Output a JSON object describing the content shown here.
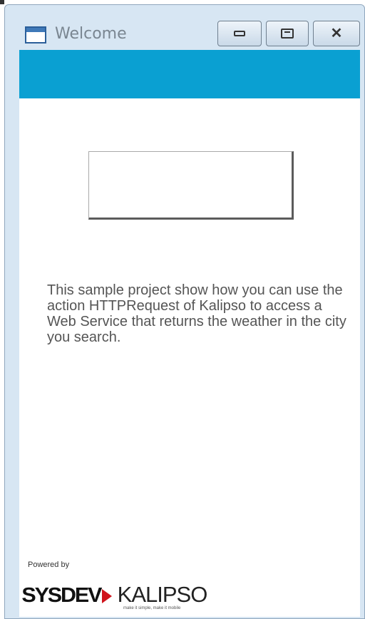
{
  "window": {
    "title": "Welcome",
    "controls": {
      "minimize": "minimize",
      "maximize": "maximize",
      "close": "close"
    }
  },
  "header": {
    "color": "#0aa0d2"
  },
  "main_button": {
    "label": ""
  },
  "description": "This sample project show how you can use the action HTTPRequest of Kalipso to access a Web Service that returns the weather in the city you search.",
  "footer": {
    "powered_by": "Powered by",
    "brand_left": "SYSDEV",
    "brand_right": "KALIPSO",
    "tagline": "make it simple, make it mobile"
  }
}
